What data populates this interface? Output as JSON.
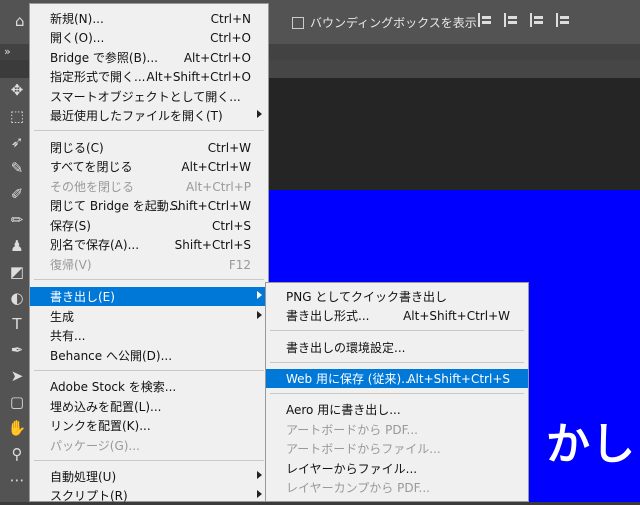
{
  "options_bar": {
    "bounding_box_label": "バウンディングボックスを表示"
  },
  "canvas": {
    "text": "かし"
  },
  "file_menu": {
    "items": [
      {
        "label": "新規(N)...",
        "shortcut": "Ctrl+N"
      },
      {
        "label": "開く(O)...",
        "shortcut": "Ctrl+O"
      },
      {
        "label": "Bridge で参照(B)...",
        "shortcut": "Alt+Ctrl+O"
      },
      {
        "label": "指定形式で開く...",
        "shortcut": "Alt+Shift+Ctrl+O"
      },
      {
        "label": "スマートオブジェクトとして開く...",
        "shortcut": ""
      },
      {
        "label": "最近使用したファイルを開く(T)",
        "shortcut": ""
      },
      {
        "label": "閉じる(C)",
        "shortcut": "Ctrl+W"
      },
      {
        "label": "すべてを閉じる",
        "shortcut": "Alt+Ctrl+W"
      },
      {
        "label": "その他を閉じる",
        "shortcut": "Alt+Ctrl+P"
      },
      {
        "label": "閉じて Bridge を起動...",
        "shortcut": "Shift+Ctrl+W"
      },
      {
        "label": "保存(S)",
        "shortcut": "Ctrl+S"
      },
      {
        "label": "別名で保存(A)...",
        "shortcut": "Shift+Ctrl+S"
      },
      {
        "label": "復帰(V)",
        "shortcut": "F12"
      },
      {
        "label": "書き出し(E)",
        "shortcut": ""
      },
      {
        "label": "生成",
        "shortcut": ""
      },
      {
        "label": "共有...",
        "shortcut": ""
      },
      {
        "label": "Behance へ公開(D)...",
        "shortcut": ""
      },
      {
        "label": "Adobe Stock を検索...",
        "shortcut": ""
      },
      {
        "label": "埋め込みを配置(L)...",
        "shortcut": ""
      },
      {
        "label": "リンクを配置(K)...",
        "shortcut": ""
      },
      {
        "label": "パッケージ(G)...",
        "shortcut": ""
      },
      {
        "label": "自動処理(U)",
        "shortcut": ""
      },
      {
        "label": "スクリプト(R)",
        "shortcut": ""
      }
    ]
  },
  "export_submenu": {
    "items": [
      {
        "label": "PNG としてクイック書き出し",
        "shortcut": ""
      },
      {
        "label": "書き出し形式...",
        "shortcut": "Alt+Shift+Ctrl+W"
      },
      {
        "label": "書き出しの環境設定...",
        "shortcut": ""
      },
      {
        "label": "Web 用に保存 (従来)...",
        "shortcut": "Alt+Shift+Ctrl+S"
      },
      {
        "label": "Aero 用に書き出し...",
        "shortcut": ""
      },
      {
        "label": "アートボードから PDF...",
        "shortcut": ""
      },
      {
        "label": "アートボードからファイル...",
        "shortcut": ""
      },
      {
        "label": "レイヤーからファイル...",
        "shortcut": ""
      },
      {
        "label": "レイヤーカンプから PDF...",
        "shortcut": ""
      }
    ]
  },
  "tab_strip": {
    "chevron": "»"
  },
  "colors": {
    "highlight": "#0078d7",
    "canvas_blue": "#0000ff"
  }
}
